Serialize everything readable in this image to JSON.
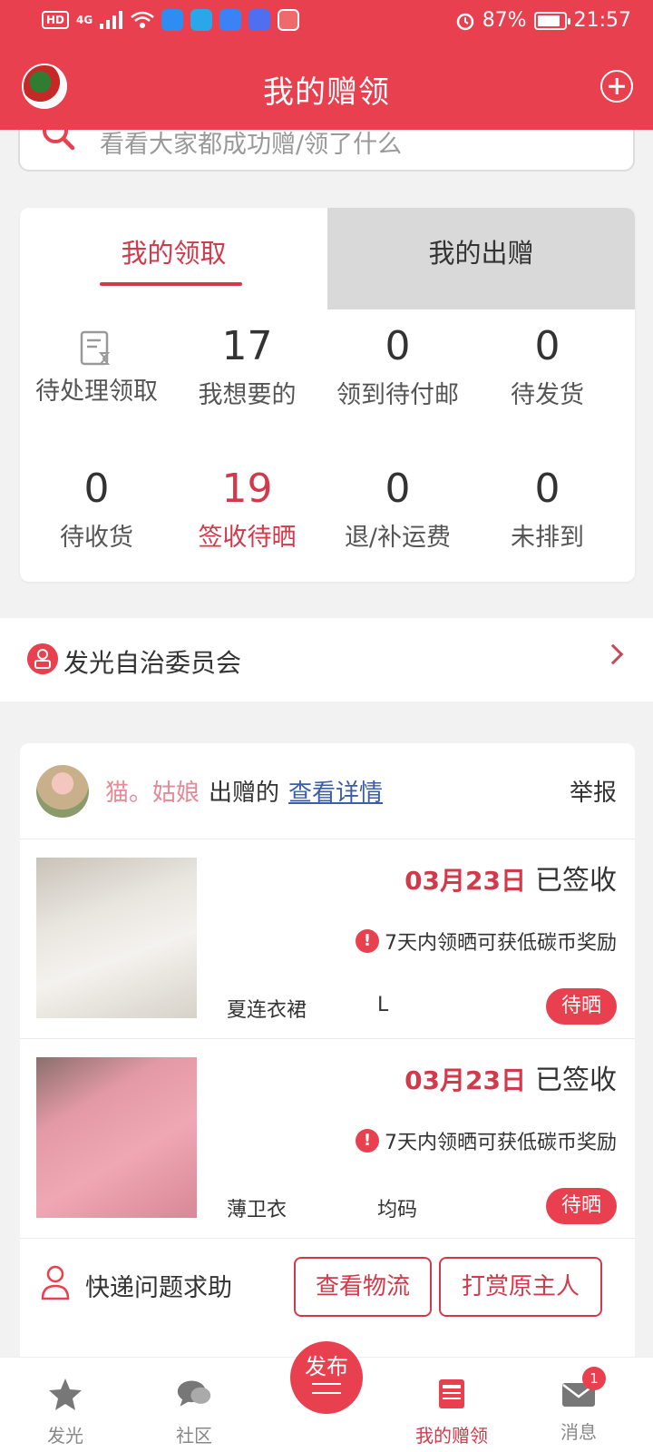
{
  "status_bar": {
    "hd": "HD",
    "network": "4G",
    "battery": "87%",
    "battery_fill": 0.87,
    "time": "21:57"
  },
  "header": {
    "title": "我的赠领"
  },
  "search": {
    "placeholder": "看看大家都成功赠/领了什么"
  },
  "tabs": [
    {
      "label": "我的领取",
      "active": true
    },
    {
      "label": "我的出赠",
      "active": false
    }
  ],
  "stats": [
    {
      "num": "",
      "label": "待处理领取",
      "icon": "document-icon"
    },
    {
      "num": "17",
      "label": "我想要的"
    },
    {
      "num": "0",
      "label": "领到待付邮"
    },
    {
      "num": "0",
      "label": "待发货"
    },
    {
      "num": "0",
      "label": "待收货"
    },
    {
      "num": "19",
      "label": "签收待晒",
      "highlight": true
    },
    {
      "num": "0",
      "label": "退/补运费"
    },
    {
      "num": "0",
      "label": "未排到"
    }
  ],
  "committee": {
    "label": "发光自治委员会"
  },
  "order": {
    "poster_name": "猫。姑娘",
    "poster_action": "出赠的",
    "detail_link": "查看详情",
    "report": "举报",
    "items": [
      {
        "date": "03月23日",
        "status": "已签收",
        "notice": "7天内领晒可获低碳币奖励",
        "name": "夏连衣裙",
        "size": "L",
        "badge": "待晒"
      },
      {
        "date": "03月23日",
        "status": "已签收",
        "notice": "7天内领晒可获低碳币奖励",
        "name": "薄卫衣",
        "size": "均码",
        "badge": "待晒"
      }
    ],
    "help_label": "快递问题求助",
    "logistics_button": "查看物流",
    "reward_button": "打赏原主人"
  },
  "bottom_nav": [
    {
      "label": "发光",
      "icon": "star-icon"
    },
    {
      "label": "社区",
      "icon": "chat-icon"
    },
    {
      "label": "发布",
      "icon": "publish-icon"
    },
    {
      "label": "我的赠领",
      "icon": "book-icon",
      "active": true
    },
    {
      "label": "消息",
      "icon": "mail-icon",
      "badge": "1"
    }
  ],
  "colors": {
    "brand": "#e8404f",
    "accent_text": "#d23a4c",
    "link": "#3b5ea8"
  }
}
